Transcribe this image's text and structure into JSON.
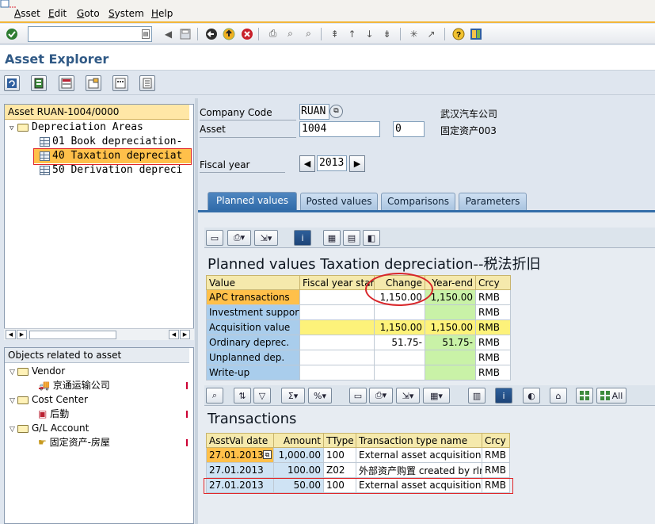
{
  "menu": {
    "items": [
      {
        "label": "Asset",
        "key": "A",
        "rest": "sset"
      },
      {
        "label": "Edit",
        "key": "E",
        "rest": "dit"
      },
      {
        "label": "Goto",
        "key": "G",
        "rest": "oto"
      },
      {
        "label": "System",
        "key": "S",
        "rest": "ystem"
      },
      {
        "label": "Help",
        "key": "H",
        "rest": "elp"
      }
    ]
  },
  "command_field": {
    "value": ""
  },
  "page_title": "Asset Explorer",
  "tree": {
    "header": "Asset RUAN-1004/0000",
    "root": "Depreciation Areas",
    "areas": [
      "01 Book depreciation-",
      "40 Taxation depreciat",
      "50 Derivation depreci"
    ],
    "selected_index": 1
  },
  "objects": {
    "header": "Objects related to asset",
    "groups": [
      {
        "label": "Vendor",
        "child": "京通运输公司"
      },
      {
        "label": "Cost Center",
        "child": "后勤"
      },
      {
        "label": "G/L Account",
        "child": "固定资产-房屋"
      }
    ]
  },
  "header_fields": {
    "company_code_label": "Company Code",
    "company_code_value": "RUAN",
    "company_name": "武汉汽车公司",
    "asset_label": "Asset",
    "asset_value": "1004",
    "subnumber_value": "0",
    "asset_name": "固定资产003",
    "fiscal_year_label": "Fiscal year",
    "fiscal_year_value": "2013"
  },
  "tabs": [
    {
      "label": "Planned values",
      "active": true
    },
    {
      "label": "Posted values",
      "active": false
    },
    {
      "label": "Comparisons",
      "active": false
    },
    {
      "label": "Parameters",
      "active": false
    }
  ],
  "planned": {
    "title": "Planned values Taxation depreciation--税法折旧",
    "columns": [
      "Value",
      "Fiscal year start",
      "Change",
      "Year-end",
      "Crcy"
    ],
    "rows": [
      {
        "label": "APC transactions",
        "fy_start": "",
        "change": "1,150.00",
        "year_end": "1,150.00",
        "crcy": "RMB"
      },
      {
        "label": "Investment support",
        "fy_start": "",
        "change": "",
        "year_end": "",
        "crcy": "RMB"
      },
      {
        "label": "Acquisition value",
        "fy_start": "",
        "change": "1,150.00",
        "year_end": "1,150.00",
        "crcy": "RMB"
      },
      {
        "label": "Ordinary deprec.",
        "fy_start": "",
        "change": "51.75-",
        "year_end": "51.75-",
        "crcy": "RMB"
      },
      {
        "label": "Unplanned dep.",
        "fy_start": "",
        "change": "",
        "year_end": "",
        "crcy": "RMB"
      },
      {
        "label": "Write-up",
        "fy_start": "",
        "change": "",
        "year_end": "",
        "crcy": "RMB"
      }
    ]
  },
  "transactions": {
    "title": "Transactions",
    "all_button": "All",
    "columns": [
      "AsstVal date",
      "Amount",
      "TType",
      "Transaction type name",
      "Crcy"
    ],
    "rows": [
      {
        "date": "27.01.2013",
        "amount": "1,000.00",
        "ttype": "100",
        "name": "External asset acquisition",
        "crcy": "RMB"
      },
      {
        "date": "27.01.2013",
        "amount": "100.00",
        "ttype": "Z02",
        "name": "外部资产购置 created by rlr",
        "crcy": "RMB"
      },
      {
        "date": "27.01.2013",
        "amount": "50.00",
        "ttype": "100",
        "name": "External asset acquisition",
        "crcy": "RMB"
      }
    ]
  },
  "colors": {
    "accent_blue": "#346ea9",
    "selection_orange": "#ffc04a",
    "annotation_red": "#d8262a"
  }
}
